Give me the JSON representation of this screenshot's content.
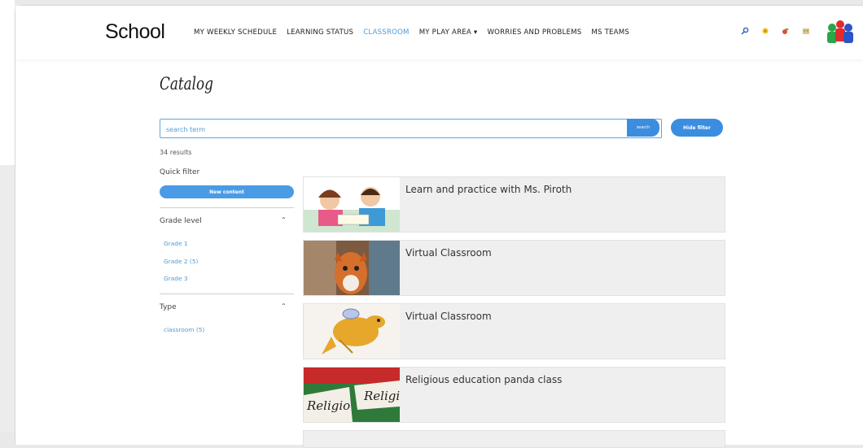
{
  "header": {
    "brand": "School",
    "nav": [
      {
        "label": "MY WEEKLY SCHEDULE",
        "active": false
      },
      {
        "label": "LEARNING STATUS",
        "active": false
      },
      {
        "label": "CLASSROOM",
        "active": true
      },
      {
        "label": "MY PLAY AREA ▾",
        "active": false
      },
      {
        "label": "WORRIES AND PROBLEMS",
        "active": false
      },
      {
        "label": "MS TEAMS",
        "active": false
      }
    ],
    "icons": [
      "search-icon",
      "settings-icon",
      "fruit-icon",
      "building-icon"
    ]
  },
  "catalog": {
    "title": "Catalog",
    "search_placeholder": "search term",
    "search_button": "search",
    "hide_filter": "Hide filter",
    "results": "34 results"
  },
  "filters": {
    "quick_label": "Quick filter",
    "new_content": "New content",
    "grade_label": "Grade level",
    "grades": [
      "Grade 1",
      "Grade 2  (5)",
      "Grade 3"
    ],
    "type_label": "Type",
    "types": [
      "classroom  (5)"
    ]
  },
  "cards": [
    {
      "title": "Learn and practice with Ms. Piroth"
    },
    {
      "title": "Virtual Classroom"
    },
    {
      "title": "Virtual Classroom"
    },
    {
      "title": "Religious education panda class",
      "thumb_words": [
        "Religio",
        "Religi"
      ]
    }
  ],
  "colors": {
    "accent": "#3b8de0",
    "link": "#4e9cd6"
  }
}
